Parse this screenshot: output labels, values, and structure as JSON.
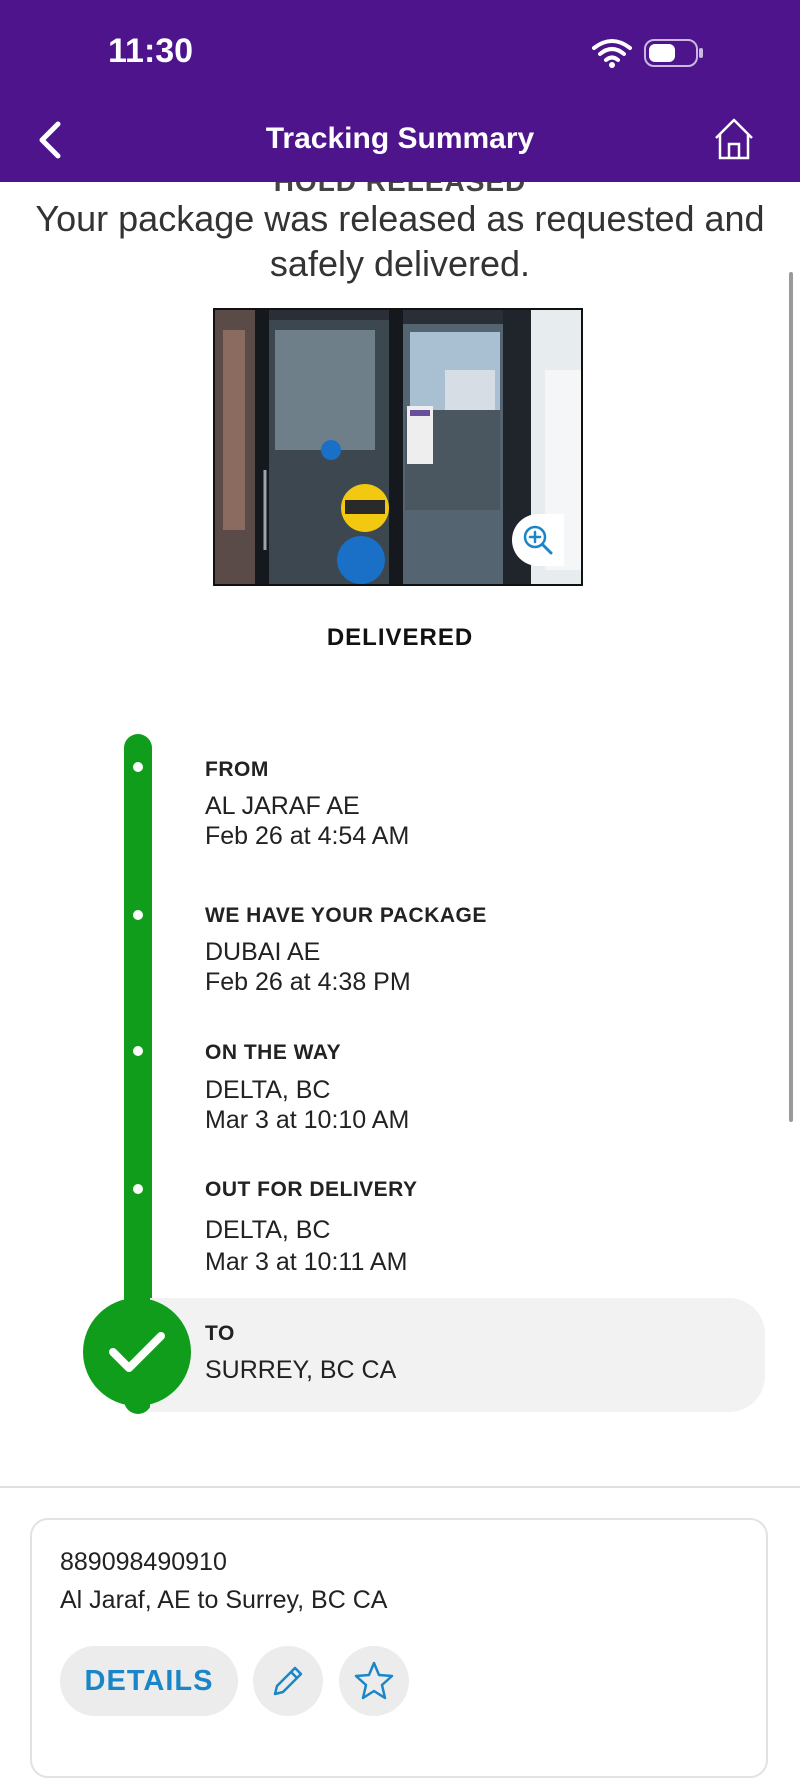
{
  "status_bar": {
    "time": "11:30"
  },
  "nav": {
    "title": "Tracking Summary",
    "back_icon": "chevron-left-icon",
    "home_icon": "home-icon"
  },
  "summary": {
    "clipped_heading": "HOLD RELEASED",
    "message": "Your package was released as requested and safely delivered.",
    "status_label": "DELIVERED",
    "photo_zoom_icon": "zoom-in-icon"
  },
  "timeline": {
    "accent_color": "#0f9d1b",
    "steps": [
      {
        "title": "FROM",
        "line1": "AL JARAF AE",
        "line2": "Feb 26 at 4:54 AM"
      },
      {
        "title": "WE HAVE YOUR PACKAGE",
        "line1": "DUBAI AE",
        "line2": "Feb 26 at 4:38 PM"
      },
      {
        "title": "ON THE WAY",
        "line1": "DELTA, BC",
        "line2": "Mar 3 at 10:10 AM"
      },
      {
        "title": "OUT FOR DELIVERY",
        "line1": "DELTA, BC",
        "line2": "Mar 3 at 10:11 AM"
      },
      {
        "title": "TO",
        "line1": "SURREY, BC  CA"
      }
    ]
  },
  "shipment_card": {
    "tracking_number": "889098490910",
    "route": "Al Jaraf, AE to Surrey, BC CA",
    "details_label": "DETAILS",
    "edit_icon": "pencil-icon",
    "star_icon": "star-icon"
  },
  "colors": {
    "header": "#4d148c",
    "link": "#1a86c8"
  }
}
